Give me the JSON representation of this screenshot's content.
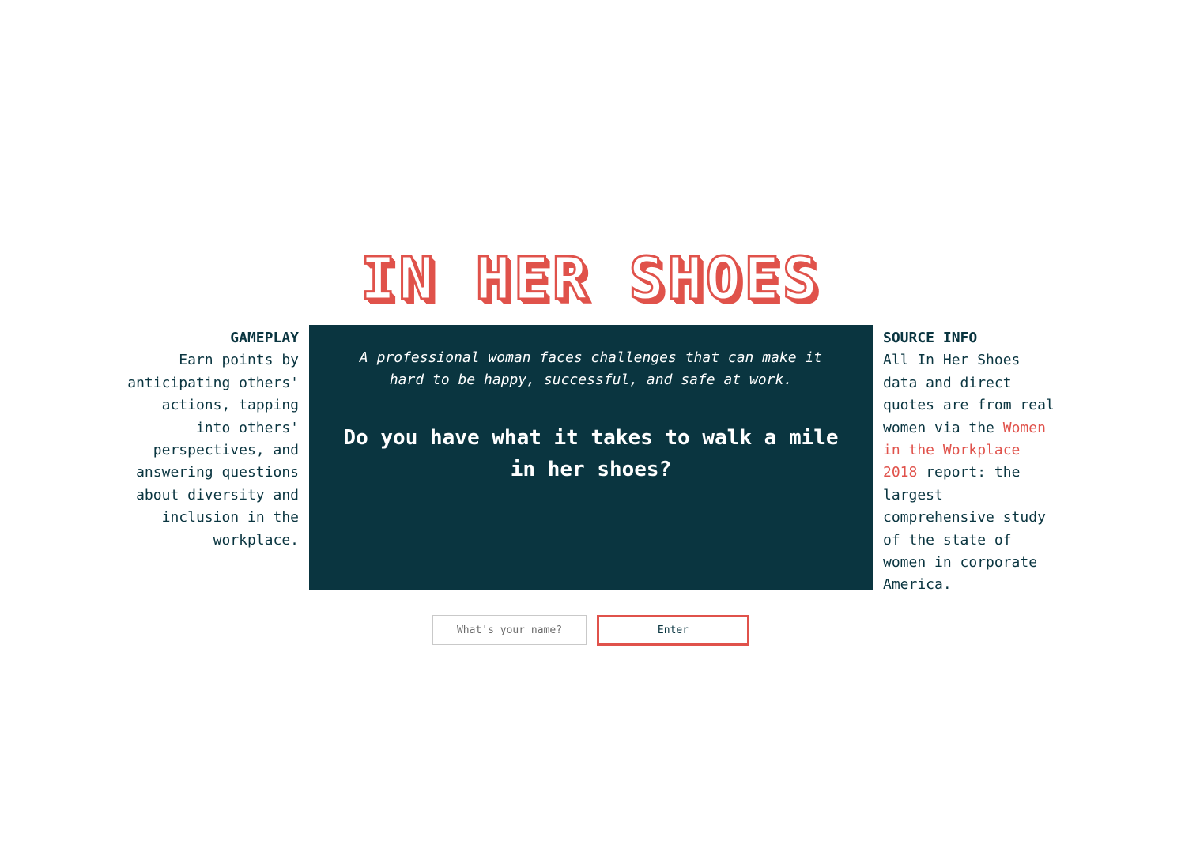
{
  "logo": {
    "text": "IN HER SHOES"
  },
  "gameplay": {
    "heading": "GAMEPLAY",
    "body": "Earn points by anticipating others' actions, tapping into others' perspectives, and answering questions about diversity and inclusion in the workplace."
  },
  "intro": {
    "description": "A professional woman faces challenges that can make it hard to be happy, successful, and safe at work.",
    "question": "Do you have what it takes to walk a mile in her shoes?"
  },
  "source_info": {
    "heading": "SOURCE INFO",
    "body_before": "All In Her Shoes data and direct quotes are from real women via the",
    "link_text": "Women in the Workplace 2018",
    "body_after": "report: the largest comprehensive study of the state of women in corporate America."
  },
  "name_form": {
    "placeholder": "What's your name?",
    "value": "",
    "button_label": "Enter"
  },
  "colors": {
    "accent": "#e0524b",
    "panel": "#0a3540",
    "text": "#0a3540",
    "background": "#ffffff"
  }
}
